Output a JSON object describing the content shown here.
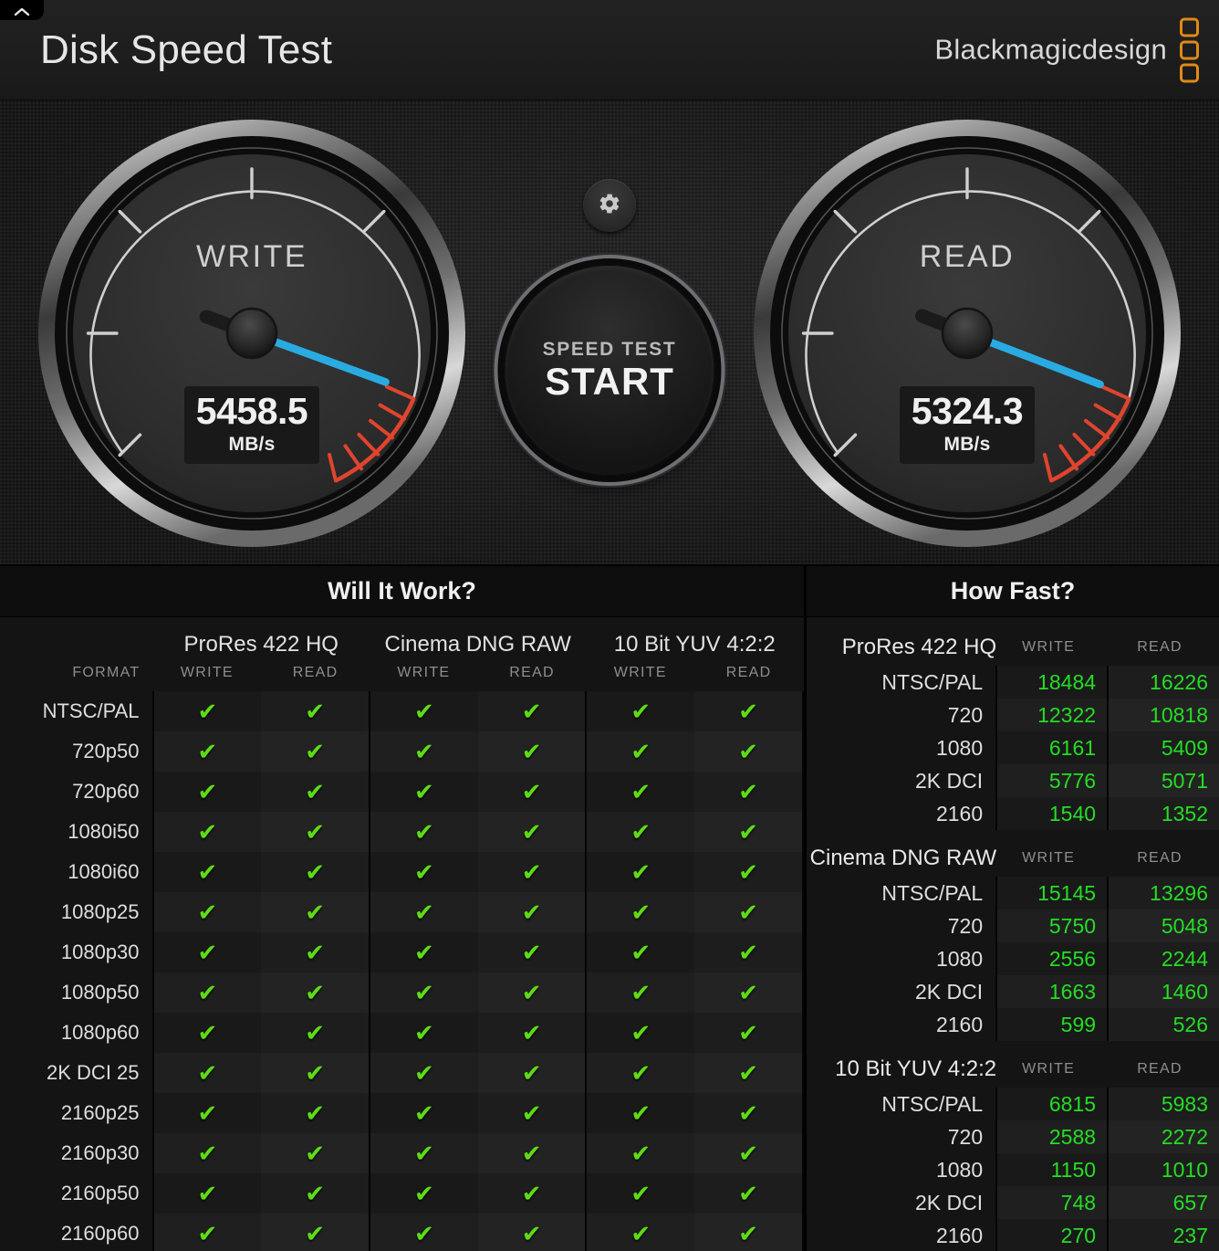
{
  "titlebar": {
    "app_title": "Disk Speed Test",
    "brand": "Blackmagicdesign",
    "collapse_icon": "chevron-up-icon",
    "brand_color": "#e08a16"
  },
  "gauges": {
    "write": {
      "label": "WRITE",
      "value": "5458.5",
      "unit": "MB/s",
      "needle_angle_deg": 20,
      "needle_color": "#29ABE2"
    },
    "read": {
      "label": "READ",
      "value": "5324.3",
      "unit": "MB/s",
      "needle_angle_deg": 21,
      "needle_color": "#29ABE2"
    },
    "start_button": {
      "line1": "SPEED TEST",
      "line2": "START"
    },
    "settings_icon": "gear-icon"
  },
  "will_it_work": {
    "title": "Will It Work?",
    "format_header": "FORMAT",
    "groups": [
      {
        "name": "ProRes 422 HQ",
        "cols": [
          "WRITE",
          "READ"
        ]
      },
      {
        "name": "Cinema DNG RAW",
        "cols": [
          "WRITE",
          "READ"
        ]
      },
      {
        "name": "10 Bit YUV 4:2:2",
        "cols": [
          "WRITE",
          "READ"
        ]
      }
    ],
    "check_symbol": "✔",
    "check_color": "#5ddc16",
    "rows": [
      {
        "format": "NTSC/PAL",
        "cells": [
          true,
          true,
          true,
          true,
          true,
          true
        ]
      },
      {
        "format": "720p50",
        "cells": [
          true,
          true,
          true,
          true,
          true,
          true
        ]
      },
      {
        "format": "720p60",
        "cells": [
          true,
          true,
          true,
          true,
          true,
          true
        ]
      },
      {
        "format": "1080i50",
        "cells": [
          true,
          true,
          true,
          true,
          true,
          true
        ]
      },
      {
        "format": "1080i60",
        "cells": [
          true,
          true,
          true,
          true,
          true,
          true
        ]
      },
      {
        "format": "1080p25",
        "cells": [
          true,
          true,
          true,
          true,
          true,
          true
        ]
      },
      {
        "format": "1080p30",
        "cells": [
          true,
          true,
          true,
          true,
          true,
          true
        ]
      },
      {
        "format": "1080p50",
        "cells": [
          true,
          true,
          true,
          true,
          true,
          true
        ]
      },
      {
        "format": "1080p60",
        "cells": [
          true,
          true,
          true,
          true,
          true,
          true
        ]
      },
      {
        "format": "2K DCI 25",
        "cells": [
          true,
          true,
          true,
          true,
          true,
          true
        ]
      },
      {
        "format": "2160p25",
        "cells": [
          true,
          true,
          true,
          true,
          true,
          true
        ]
      },
      {
        "format": "2160p30",
        "cells": [
          true,
          true,
          true,
          true,
          true,
          true
        ]
      },
      {
        "format": "2160p50",
        "cells": [
          true,
          true,
          true,
          true,
          true,
          true
        ]
      },
      {
        "format": "2160p60",
        "cells": [
          true,
          true,
          true,
          true,
          true,
          true
        ]
      }
    ]
  },
  "how_fast": {
    "title": "How Fast?",
    "value_color": "#24dd24",
    "groups": [
      {
        "name": "ProRes 422 HQ",
        "write_header": "WRITE",
        "read_header": "READ",
        "rows": [
          {
            "format": "NTSC/PAL",
            "write": "18484",
            "read": "16226"
          },
          {
            "format": "720",
            "write": "12322",
            "read": "10818"
          },
          {
            "format": "1080",
            "write": "6161",
            "read": "5409"
          },
          {
            "format": "2K DCI",
            "write": "5776",
            "read": "5071"
          },
          {
            "format": "2160",
            "write": "1540",
            "read": "1352"
          }
        ]
      },
      {
        "name": "Cinema DNG RAW",
        "write_header": "WRITE",
        "read_header": "READ",
        "rows": [
          {
            "format": "NTSC/PAL",
            "write": "15145",
            "read": "13296"
          },
          {
            "format": "720",
            "write": "5750",
            "read": "5048"
          },
          {
            "format": "1080",
            "write": "2556",
            "read": "2244"
          },
          {
            "format": "2K DCI",
            "write": "1663",
            "read": "1460"
          },
          {
            "format": "2160",
            "write": "599",
            "read": "526"
          }
        ]
      },
      {
        "name": "10 Bit YUV 4:2:2",
        "write_header": "WRITE",
        "read_header": "READ",
        "rows": [
          {
            "format": "NTSC/PAL",
            "write": "6815",
            "read": "5983"
          },
          {
            "format": "720",
            "write": "2588",
            "read": "2272"
          },
          {
            "format": "1080",
            "write": "1150",
            "read": "1010"
          },
          {
            "format": "2K DCI",
            "write": "748",
            "read": "657"
          },
          {
            "format": "2160",
            "write": "270",
            "read": "237"
          }
        ]
      }
    ]
  }
}
